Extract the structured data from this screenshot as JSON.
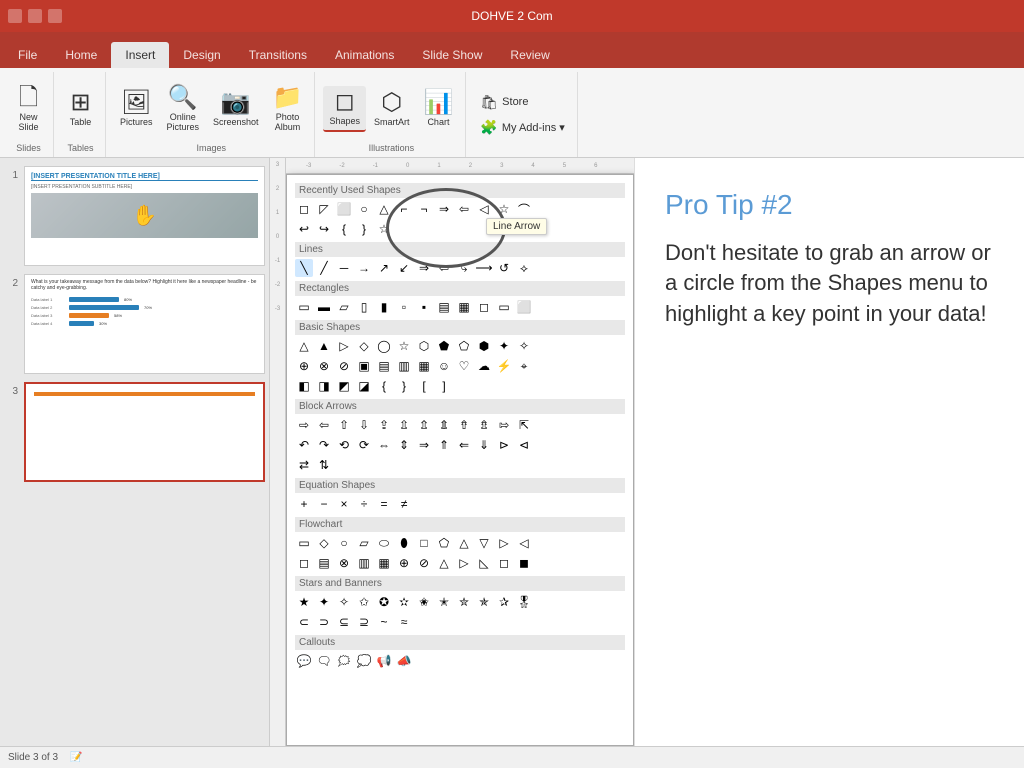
{
  "titleBar": {
    "appTitle": "DOHVE 2 Com",
    "buttons": [
      "minimize",
      "restore",
      "close"
    ]
  },
  "ribbonTabs": {
    "tabs": [
      "File",
      "Home",
      "Insert",
      "Design",
      "Transitions",
      "Animations",
      "Slide Show",
      "Review"
    ],
    "activeTab": "Insert"
  },
  "ribbon": {
    "groups": [
      {
        "name": "Slides",
        "buttons": [
          {
            "label": "New\nSlide",
            "icon": "🗋"
          }
        ]
      },
      {
        "name": "Tables",
        "buttons": [
          {
            "label": "Table",
            "icon": "⊞"
          }
        ]
      },
      {
        "name": "Images",
        "buttons": [
          {
            "label": "Pictures",
            "icon": "🖼"
          },
          {
            "label": "Online\nPictures",
            "icon": "🔍"
          },
          {
            "label": "Screenshot",
            "icon": "📷"
          },
          {
            "label": "Photo\nAlbum",
            "icon": "📁"
          }
        ]
      },
      {
        "name": "Illustrations",
        "buttons": [
          {
            "label": "Shapes",
            "icon": "◻"
          },
          {
            "label": "SmartArt",
            "icon": "⬡"
          },
          {
            "label": "Chart",
            "icon": "📊"
          }
        ]
      }
    ],
    "storeItems": [
      {
        "label": "Store",
        "icon": "🛍"
      },
      {
        "label": "My Add-ins ▾",
        "icon": "🧩"
      }
    ]
  },
  "slides": [
    {
      "num": "1",
      "title": "[INSERT PRESENTATION TITLE HERE]",
      "subtitle": "[INSERT PRESENTATION SUBTITLE HERE]",
      "hasImage": true
    },
    {
      "num": "2",
      "bodyText": "What is your takeaway message from the data below? Highlight it here like a newspaper headline - be catchy and eye-grabbing.",
      "bars": [
        {
          "label": "Data label 1",
          "pct": 80,
          "color": "#2980b9"
        },
        {
          "label": "Data label 2",
          "pct": 70,
          "color": "#2980b9"
        },
        {
          "label": "Data label 3",
          "pct": 58,
          "color": "#e67e22"
        },
        {
          "label": "Data label 4",
          "pct": 30,
          "color": "#2980b9"
        }
      ]
    },
    {
      "num": "3",
      "selected": true
    }
  ],
  "shapesPanel": {
    "recentlyUsedLabel": "Recently Used Shapes",
    "sections": [
      {
        "title": "Lines",
        "shapes": [
          "╲",
          "╱",
          "─",
          "│",
          "↗",
          "↙",
          "⟶",
          "⟵",
          "⤷",
          "⇒",
          "↺",
          "⟡"
        ]
      },
      {
        "title": "Rectangles",
        "shapes": [
          "▭",
          "▬",
          "▱",
          "▯",
          "▮",
          "▫",
          "▪",
          "▤",
          "▦"
        ]
      },
      {
        "title": "Basic Shapes",
        "shapes": [
          "△",
          "▲",
          "▷",
          "◇",
          "◯",
          "☆",
          "⬡",
          "⬟",
          "⬠",
          "⬢",
          "✦",
          "✧"
        ]
      },
      {
        "title": "Block Arrows",
        "shapes": [
          "⇨",
          "⇦",
          "⇧",
          "⇩",
          "⇪",
          "⇫",
          "⇬",
          "⇭",
          "⇮",
          "⇯",
          "⇰",
          "⇱"
        ]
      },
      {
        "title": "Equation Shapes",
        "shapes": [
          "+",
          "−",
          "×",
          "÷",
          "=",
          "≠"
        ]
      },
      {
        "title": "Flowchart",
        "shapes": [
          "▭",
          "◇",
          "○",
          "▱",
          "▷",
          "⬭",
          "□",
          "⬠",
          "△",
          "▽",
          "▷",
          "◁"
        ]
      },
      {
        "title": "Stars and Banners",
        "shapes": [
          "★",
          "✦",
          "✧",
          "✩",
          "✪",
          "✫",
          "✬",
          "✭",
          "✮",
          "✯",
          "✰",
          "🎖"
        ]
      },
      {
        "title": "Callouts",
        "shapes": [
          "💬",
          "🗨",
          "🗯",
          "💭",
          "📢",
          "📣"
        ]
      }
    ],
    "lineArrowTooltip": "Line Arrow"
  },
  "proTip": {
    "title": "Pro Tip #2",
    "body": "Don't hesitate to grab an arrow or a circle from the Shapes menu to highlight a key point in your data!"
  },
  "statusBar": {
    "slideInfo": "Slide 3 of 3",
    "noteIcon": "📝"
  }
}
